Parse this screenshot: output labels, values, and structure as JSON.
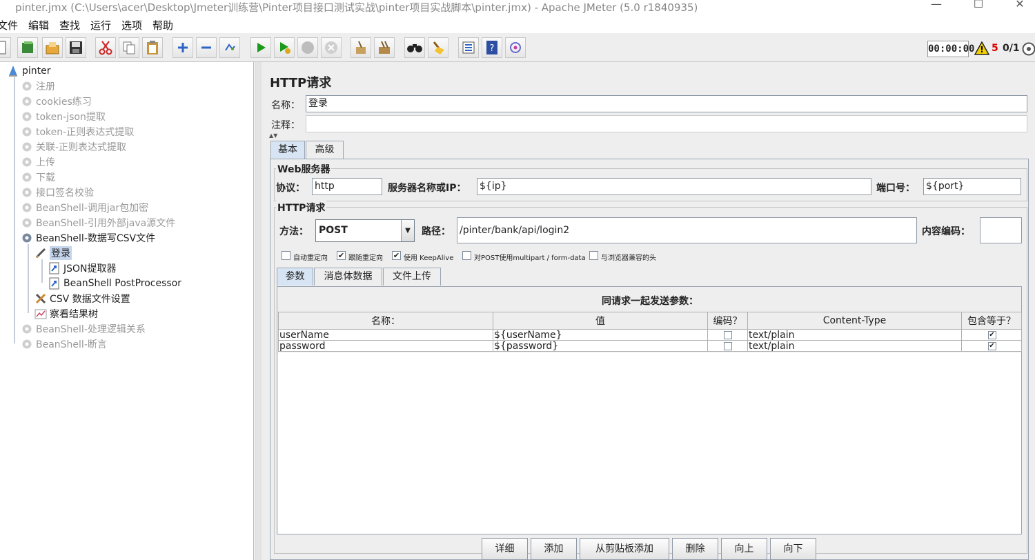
{
  "window": {
    "title": "pinter.jmx (C:\\Users\\acer\\Desktop\\Jmeter训练营\\Pinter项目接口测试实战\\pinter项目实战脚本\\pinter.jmx) - Apache JMeter (5.0 r1840935)",
    "controls": [
      "—",
      "☐",
      "✕"
    ]
  },
  "menu": [
    "文件",
    "编辑",
    "查找",
    "运行",
    "选项",
    "帮助"
  ],
  "toolbar": {
    "buttons": [
      {
        "icon": "new-icon"
      },
      {
        "icon": "templates-icon"
      },
      {
        "icon": "open-icon"
      },
      {
        "icon": "save-icon"
      },
      {
        "icon": "cut-icon"
      },
      {
        "icon": "copy-icon"
      },
      {
        "icon": "paste-icon"
      },
      {
        "icon": "expand-icon"
      },
      {
        "icon": "collapse-icon"
      },
      {
        "icon": "toggle-icon"
      },
      {
        "icon": "start-icon"
      },
      {
        "icon": "start-no-pause-icon"
      },
      {
        "icon": "stop-icon"
      },
      {
        "icon": "shutdown-icon"
      },
      {
        "icon": "clear-icon"
      },
      {
        "icon": "clear-all-icon"
      },
      {
        "icon": "search-icon"
      },
      {
        "icon": "reset-search-icon"
      },
      {
        "icon": "function-helper-icon"
      },
      {
        "icon": "help-icon"
      },
      {
        "icon": "remote-icon"
      }
    ],
    "timer": "00:00:00",
    "error_count": "5",
    "threads": "0/1"
  },
  "tree": {
    "root": "pinter",
    "items": [
      {
        "label": "注册",
        "enabled": false
      },
      {
        "label": "cookies练习",
        "enabled": false
      },
      {
        "label": "token-json提取",
        "enabled": false
      },
      {
        "label": "token-正则表达式提取",
        "enabled": false
      },
      {
        "label": "关联-正则表达式提取",
        "enabled": false
      },
      {
        "label": "上传",
        "enabled": false
      },
      {
        "label": "下载",
        "enabled": false
      },
      {
        "label": "接口签名校验",
        "enabled": false
      },
      {
        "label": "BeanShell-调用jar包加密",
        "enabled": false
      },
      {
        "label": "BeanShell-引用外部java源文件",
        "enabled": false
      },
      {
        "label": "BeanShell-数据写CSV文件",
        "enabled": true
      }
    ],
    "sampler": "登录",
    "sampler_children": [
      "JSON提取器",
      "BeanShell PostProcessor"
    ],
    "config": "CSV 数据文件设置",
    "listener": "察看结果树",
    "after": [
      {
        "label": "BeanShell-处理逻辑关系",
        "enabled": false
      },
      {
        "label": "BeanShell-断言",
        "enabled": false
      }
    ]
  },
  "editor": {
    "title": "HTTP请求",
    "name_label": "名称：",
    "name_value": "登录",
    "comment_label": "注释：",
    "comment_value": "",
    "tabs": [
      "基本",
      "高级"
    ],
    "web_server": {
      "title": "Web服务器",
      "protocol_label": "协议：",
      "protocol_value": "http",
      "server_label": "服务器名称或IP：",
      "server_value": "${ip}",
      "port_label": "端口号：",
      "port_value": "${port}"
    },
    "http_request": {
      "title": "HTTP请求",
      "method_label": "方法：",
      "method_value": "POST",
      "path_label": "路径：",
      "path_value": "/pinter/bank/api/login2",
      "encoding_label": "内容编码：",
      "encoding_value": ""
    },
    "options": [
      {
        "label": "自动重定向",
        "checked": false
      },
      {
        "label": "跟随重定向",
        "checked": true
      },
      {
        "label": "使用 KeepAlive",
        "checked": true
      },
      {
        "label": "对POST使用multipart / form-data",
        "checked": false
      },
      {
        "label": "与浏览器兼容的头",
        "checked": false
      }
    ],
    "sub_tabs": [
      "参数",
      "消息体数据",
      "文件上传"
    ],
    "params": {
      "title": "同请求一起发送参数：",
      "columns": [
        "名称：",
        "值",
        "编码？",
        "Content-Type",
        "包含等于？"
      ],
      "rows": [
        {
          "name": "userName",
          "value": "${userName}",
          "encode": false,
          "content_type": "text/plain",
          "include_equals": true
        },
        {
          "name": "password",
          "value": "${password}",
          "encode": false,
          "content_type": "text/plain",
          "include_equals": true
        }
      ]
    },
    "buttons": [
      "详细",
      "添加",
      "从剪贴板添加",
      "删除",
      "向上",
      "向下"
    ]
  }
}
